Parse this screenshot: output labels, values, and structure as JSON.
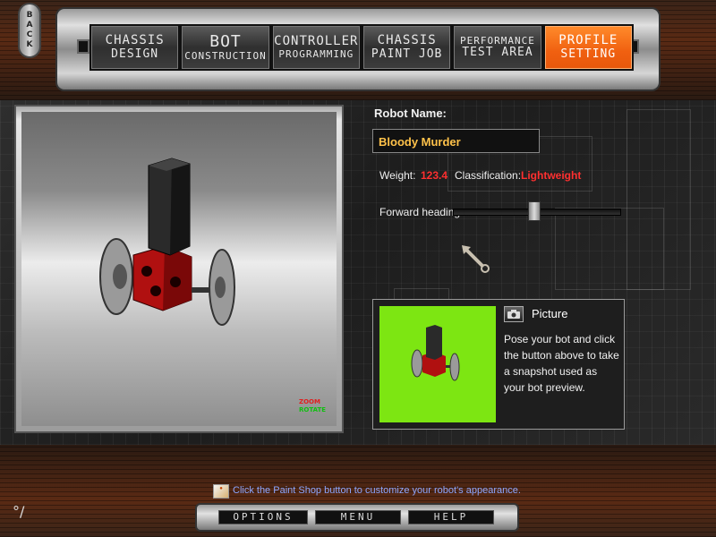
{
  "back_button": {
    "label": "BACK"
  },
  "nav": {
    "tabs": [
      {
        "line1": "CHASSIS",
        "line2": "DESIGN",
        "active": false
      },
      {
        "line1": "BOT",
        "line2": "CONSTRUCTION",
        "active": false
      },
      {
        "line1": "CONTROLLER",
        "line2": "PROGRAMMING",
        "active": false
      },
      {
        "line1": "CHASSIS",
        "line2": "PAINT JOB",
        "active": false
      },
      {
        "line1": "PERFORMANCE",
        "line2": "TEST AREA",
        "active": false
      },
      {
        "line1": "PROFILE",
        "line2": "SETTING",
        "active": true
      }
    ]
  },
  "viewport": {
    "zoom_label": "ZOOM",
    "rotate_label": "ROTATE"
  },
  "profile": {
    "robot_name_label": "Robot Name:",
    "robot_name_value": "Bloody Murder",
    "weight_label": "Weight:",
    "weight_value": "123.4",
    "classification_label": "Classification:",
    "classification_value": "Lightweight",
    "forward_heading_label": "Forward heading:",
    "forward_heading_level": 0.49
  },
  "picture": {
    "title": "Picture",
    "description": "Pose your bot and click the button above to take a snapshot used as your bot preview."
  },
  "footer": {
    "hint": "Click the Paint Shop button to customize your robot's appearance.",
    "buttons": {
      "options": "OPTIONS",
      "menu": "MENU",
      "help": "HELP"
    }
  },
  "colors": {
    "active_tab": "#f06010",
    "name_value": "#ffc24a",
    "stat_value": "#ff3030",
    "hint_text": "#8fa8ff",
    "thumbnail_bg": "#7de612",
    "robot_body": "#b01010"
  },
  "icons": [
    "camera-icon",
    "paint-shop-icon",
    "heading-arrow-icon"
  ]
}
